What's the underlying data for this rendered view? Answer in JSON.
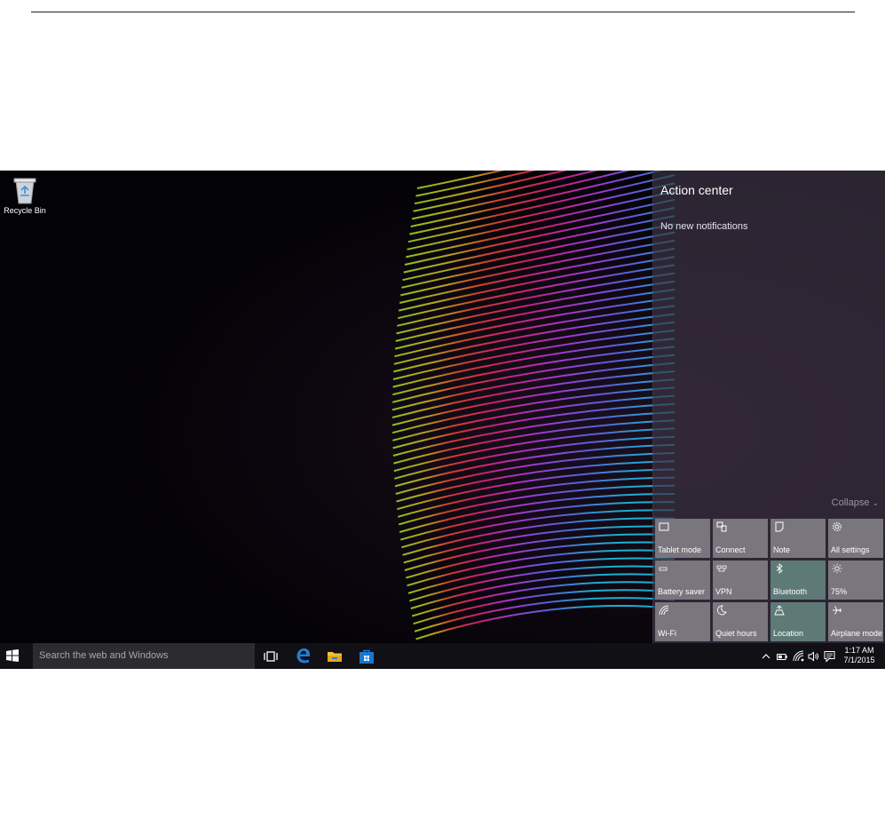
{
  "desktop": {
    "recycle_bin_label": "Recycle Bin"
  },
  "action_center": {
    "title": "Action center",
    "empty_text": "No new notifications",
    "collapse_label": "Collapse",
    "quick_actions": [
      {
        "label": "Tablet mode",
        "icon": "tablet-mode-icon",
        "active": false
      },
      {
        "label": "Connect",
        "icon": "connect-icon",
        "active": false
      },
      {
        "label": "Note",
        "icon": "note-icon",
        "active": false
      },
      {
        "label": "All settings",
        "icon": "gear-icon",
        "active": false
      },
      {
        "label": "Battery saver",
        "icon": "battery-saver-icon",
        "active": false
      },
      {
        "label": "VPN",
        "icon": "vpn-icon",
        "active": false
      },
      {
        "label": "Bluetooth",
        "icon": "bluetooth-icon",
        "active": true
      },
      {
        "label": "75%",
        "icon": "brightness-icon",
        "active": false
      },
      {
        "label": "Wi-Fi",
        "icon": "wifi-icon",
        "active": false
      },
      {
        "label": "Quiet hours",
        "icon": "moon-icon",
        "active": false
      },
      {
        "label": "Location",
        "icon": "location-icon",
        "active": true
      },
      {
        "label": "Airplane mode",
        "icon": "airplane-icon",
        "active": false
      }
    ]
  },
  "taskbar": {
    "search_placeholder": "Search the web and Windows",
    "clock_time": "1:17 AM",
    "clock_date": "7/1/2015"
  },
  "colors": {
    "tile_off": "#7a767d",
    "tile_on": "#5e7a77",
    "edge_blue": "#1e7fd6",
    "store_blue": "#1778d0",
    "folder_yellow": "#f0c23b"
  }
}
